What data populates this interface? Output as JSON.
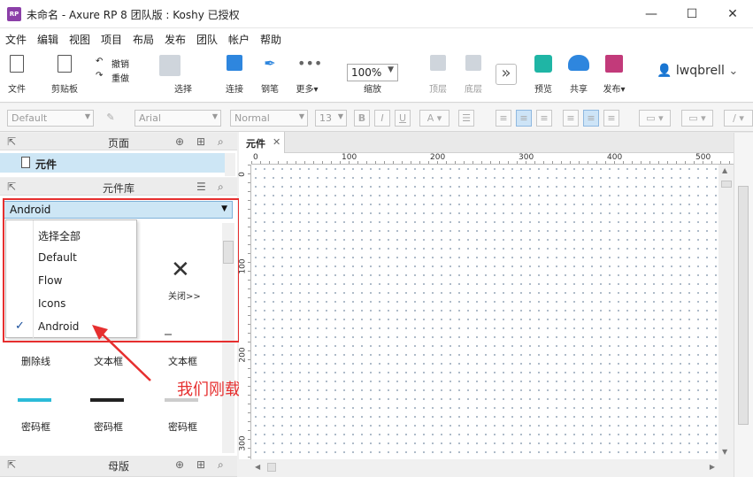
{
  "window": {
    "app_icon": "RP",
    "title": "未命名 - Axure RP 8 团队版 : Koshy 已授权",
    "minimize": "—",
    "maximize": "☐",
    "close": "✕"
  },
  "menu": [
    "文件",
    "编辑",
    "视图",
    "项目",
    "布局",
    "发布",
    "团队",
    "帐户",
    "帮助"
  ],
  "toolbar": {
    "file": "文件",
    "clipboard": "剪贴板",
    "undo": "撤销",
    "redo": "重做",
    "select": "选择",
    "connect": "连接",
    "pen": "钢笔",
    "more": "更多",
    "zoom_value": "100%",
    "zoom_label": "缩放",
    "top": "顶层",
    "bottom": "底层",
    "preview": "预览",
    "share": "共享",
    "publish": "发布",
    "user": "lwqbrell"
  },
  "format": {
    "style": "Default",
    "font": "Arial",
    "weight": "Normal",
    "size": "13",
    "bold": "B",
    "italic": "I",
    "underline": "U",
    "font_color": "A"
  },
  "pages_panel": {
    "title": "页面",
    "page": "元件"
  },
  "library_panel": {
    "title": "元件库",
    "selected": "Android",
    "options": [
      "选择全部",
      "Default",
      "Flow",
      "Icons",
      "Android"
    ],
    "checked_index": 4,
    "close_label": "关闭>>",
    "widgets_row1": [
      "删除线",
      "文本框",
      "文本框"
    ],
    "widgets_row2": [
      "密码框",
      "密码框",
      "密码框"
    ]
  },
  "masters_panel": {
    "title": "母版"
  },
  "annotation": "我们刚载入的元件",
  "canvas": {
    "tab": "元件",
    "tab_close": "✕",
    "ruler_h": [
      "0",
      "100",
      "200",
      "300",
      "400",
      "500"
    ],
    "ruler_v": [
      "0",
      "100",
      "200",
      "300"
    ]
  },
  "colors": {
    "accent": "#cde6f5",
    "highlight": "#e62f2f",
    "check": "#1a4f9c"
  }
}
